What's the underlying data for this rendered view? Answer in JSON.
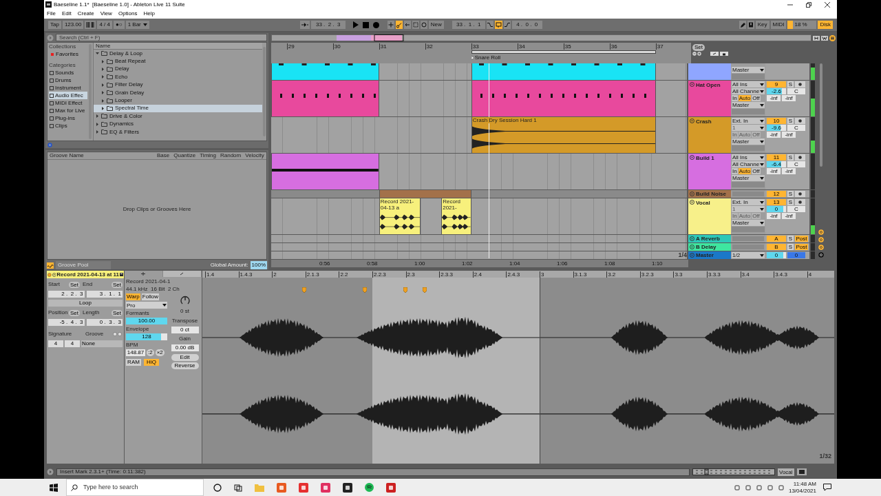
{
  "window": {
    "title": "Baeseline 1.1*  [Baeseline 1.0] - Ableton Live 11 Suite"
  },
  "menu": [
    "File",
    "Edit",
    "Create",
    "View",
    "Options",
    "Help"
  ],
  "transport": {
    "tap": "Tap",
    "tempo": "123.00",
    "signature": "4 / 4",
    "metronome": "●○",
    "quantize": "1 Bar",
    "position": "33 .  2 .  3",
    "new": "New",
    "automation_arm": true,
    "loop_start": "33 .  1 .  1",
    "loop_on": true,
    "loop_length": "4 .  0 .  0",
    "key": "Key",
    "midi": "MIDI",
    "cpu": {
      "reading": "18 %",
      "level": 0.18
    },
    "disk": "Disk",
    "disk_overload": true
  },
  "browser": {
    "search_placeholder": "Search (Ctrl + F)",
    "collections_heading": "Collections",
    "collections": [
      {
        "label": "Favorites",
        "color": "#e82020"
      }
    ],
    "categories_heading": "Categories",
    "categories": [
      {
        "label": "Sounds",
        "selected": false
      },
      {
        "label": "Drums",
        "selected": false
      },
      {
        "label": "Instrument",
        "selected": false
      },
      {
        "label": "Audio Effec",
        "selected": true
      },
      {
        "label": "MIDI Effect",
        "selected": false
      },
      {
        "label": "Max for Live",
        "selected": false
      },
      {
        "label": "Plug-ins",
        "selected": false
      },
      {
        "label": "Clips",
        "selected": false
      }
    ],
    "name_heading": "Name",
    "items": [
      {
        "label": "Delay & Loop",
        "expanded": true,
        "selected": false,
        "children": [
          {
            "label": "Beat Repeat",
            "expanded": false,
            "selected": false
          },
          {
            "label": "Delay",
            "expanded": false,
            "selected": false
          },
          {
            "label": "Echo",
            "expanded": false,
            "selected": false
          },
          {
            "label": "Filter Delay",
            "expanded": false,
            "selected": false
          },
          {
            "label": "Grain Delay",
            "expanded": false,
            "selected": false
          },
          {
            "label": "Looper",
            "expanded": false,
            "selected": false
          },
          {
            "label": "Spectral Time",
            "expanded": false,
            "selected": true
          }
        ]
      },
      {
        "label": "Drive & Color",
        "expanded": false,
        "selected": false
      },
      {
        "label": "Dynamics",
        "expanded": false,
        "selected": false
      },
      {
        "label": "EQ & Filters",
        "expanded": false,
        "selected": false
      }
    ]
  },
  "groove_pool": {
    "columns": [
      "Groove Name",
      "Base",
      "Quantize",
      "Timing",
      "Random",
      "Velocity"
    ],
    "empty_text": "Drop Clips or Grooves Here",
    "title": "Groove Pool",
    "global_amount_label": "Global Amount:",
    "global_amount": "100%"
  },
  "arrangement": {
    "bars": [
      "29",
      "30",
      "31",
      "32",
      "33",
      "34",
      "35",
      "36",
      "37"
    ],
    "locators": [
      {
        "label": "Snare Roll"
      }
    ],
    "times": [
      "0:56",
      "0:58",
      "1:00",
      "1:02",
      "1:04",
      "1:06",
      "1:08",
      "1:10"
    ],
    "zoom": "1/4",
    "set_button": "Set",
    "tracks": [
      {
        "kind": "partial",
        "color": "#8fa6ff",
        "output": "Master",
        "meter": {
          "level": 0.75
        },
        "clips": [
          {
            "kind": "hits",
            "color": "#19e3f5"
          },
          {
            "kind": "hits",
            "color": "#19e3f5"
          }
        ]
      },
      {
        "kind": "track",
        "name": "Hat Open",
        "color": "#e8499d",
        "input_type": "All Ins",
        "input_channel": "All Channe",
        "monitor_enabled": true,
        "monitor": [
          {
            "label": "In",
            "selected": false
          },
          {
            "label": "Auto",
            "selected": true
          },
          {
            "label": "Off",
            "selected": false
          }
        ],
        "output": "Master",
        "number": "9",
        "solo": "S",
        "volume": {
          "reading": "-2.6",
          "level": 0.8
        },
        "pan": "C",
        "sends": [
          "-inf",
          "-inf"
        ],
        "meter": {
          "level": 0.5
        },
        "clips": [
          {
            "kind": "steps",
            "color": "#e8499d"
          },
          {
            "kind": "steps",
            "color": "#e8499d"
          }
        ]
      },
      {
        "kind": "track",
        "name": "Crash",
        "color": "#d49a28",
        "input_type": "Ext. In",
        "input_channel": "1",
        "monitor_enabled": false,
        "monitor": [
          {
            "label": "In",
            "selected": false
          },
          {
            "label": "Auto",
            "selected": false
          },
          {
            "label": "Off",
            "selected": false
          }
        ],
        "output": "Master",
        "number": "10",
        "solo": "S",
        "volume": {
          "reading": "-9.6",
          "level": 0.7
        },
        "pan": "C",
        "sends": [
          "-inf",
          "-inf"
        ],
        "meter": {
          "level": 0.35
        },
        "clips": [
          {
            "kind": "decay",
            "color": "#d49a28",
            "label": "Crash Dry Session Hard 1"
          }
        ]
      },
      {
        "kind": "track",
        "name": "Build 1",
        "color": "#d66ee0",
        "input_type": "All Ins",
        "input_channel": "All Channe",
        "monitor_enabled": true,
        "monitor": [
          {
            "label": "In",
            "selected": false
          },
          {
            "label": "Auto",
            "selected": true
          },
          {
            "label": "Off",
            "selected": false
          }
        ],
        "output": "Master",
        "number": "11",
        "solo": "S",
        "volume": {
          "reading": "-6.4",
          "level": 0.75
        },
        "pan": "C",
        "sends": [
          "-inf",
          "-inf"
        ],
        "clips": [
          {
            "kind": "held",
            "color": "#d66ee0"
          }
        ]
      },
      {
        "kind": "folded",
        "name": "Build Noise",
        "color": "#a3714a",
        "number": "12",
        "solo": "S",
        "clips": [
          {
            "kind": "plain",
            "color": "#a3714a"
          }
        ]
      },
      {
        "kind": "track",
        "name": "Vocal",
        "color": "#f7f08a",
        "input_type": "Ext. In",
        "input_channel": "1",
        "monitor_enabled": false,
        "monitor": [
          {
            "label": "In",
            "selected": false
          },
          {
            "label": "Auto",
            "selected": false
          },
          {
            "label": "Off",
            "selected": false
          }
        ],
        "output": "Master",
        "number": "13",
        "solo": "S",
        "volume": {
          "reading": "0",
          "level": 0.85
        },
        "pan": "C",
        "sends": [
          "-inf",
          "-inf"
        ],
        "meter": {
          "level": 0.25
        },
        "clips": [
          {
            "kind": "speech",
            "color": "#f7f07c",
            "label": "Record 2021-04-13 a"
          },
          {
            "kind": "speech",
            "color": "#f7f07c",
            "label": "Record 2021-"
          }
        ]
      },
      {
        "kind": "return",
        "name": "A Reverb",
        "color": "#2ec8b8",
        "number": "A",
        "solo": "S",
        "post": "Post"
      },
      {
        "kind": "return",
        "name": "B Delay",
        "color": "#3ee6a0",
        "number": "B",
        "solo": "S",
        "post": "Post"
      },
      {
        "kind": "master",
        "name": "Master",
        "color": "#1b78c8",
        "output": "1/2",
        "volume": {
          "reading": "0",
          "level": 0.85
        },
        "pan": "0"
      }
    ]
  },
  "clip": {
    "title": "Record 2021-04-13 at 11",
    "color": "#f7f07c",
    "start_label": "Start",
    "start_set": "Set",
    "end_label": "End",
    "end_set": "Set",
    "start": "2 .  2 .  3",
    "end": "3 .  1 .  1",
    "loop": "Loop",
    "loop_on": false,
    "position_label": "Position",
    "position_set": "Set",
    "length_label": "Length",
    "length_set": "Set",
    "position": "-5 .  4 .  3",
    "length": "0 .  3 .  3",
    "signature_label": "Signature",
    "signature": [
      "4",
      "4"
    ],
    "groove_label": "Groove",
    "groove": "None"
  },
  "sample": {
    "tabs": [
      {
        "selected": true
      },
      {
        "selected": false
      }
    ],
    "name": "Record 2021-04-1",
    "info": "44.1 kHz  16 Bit  2 Ch",
    "warp": {
      "label": "Warp",
      "on": true
    },
    "follow": {
      "label": "Follow",
      "on": false
    },
    "mode": "Pro",
    "formants_label": "Formants",
    "formants": {
      "reading": "100.00",
      "level": 1
    },
    "envelope_label": "Envelope",
    "envelope": {
      "reading": "128",
      "level": 0.85
    },
    "bpm_label": "BPM",
    "bpm": "148.87",
    "halve": ":2",
    "double": "×2",
    "ram": {
      "label": "RAM",
      "on": false
    },
    "hiq": {
      "label": "HiQ",
      "on": true
    },
    "transpose": "0 st",
    "transpose_label": "Transpose",
    "detune": "0 ct",
    "gain_label": "Gain",
    "gain": "0.00 dB",
    "edit": "Edit",
    "reverse": "Reverse"
  },
  "editor": {
    "ruler": [
      "1.4",
      "1.4.3",
      "2",
      "2.1.3",
      "2.2",
      "2.2.3",
      "2.3",
      "2.3.3",
      "2.4",
      "2.4.3",
      "3",
      "3.1.3",
      "3.2",
      "3.2.3",
      "3.3",
      "3.3.3",
      "3.4",
      "3.4.3",
      "4"
    ],
    "zoom": "1/32"
  },
  "status_bar": {
    "message": "Insert Mark 2.3.1+ (Time: 0:11:382)",
    "track": "Vocal"
  },
  "taskbar": {
    "search_placeholder": "Type here to search",
    "time": "11:48 AM",
    "date": "13/04/2021"
  }
}
